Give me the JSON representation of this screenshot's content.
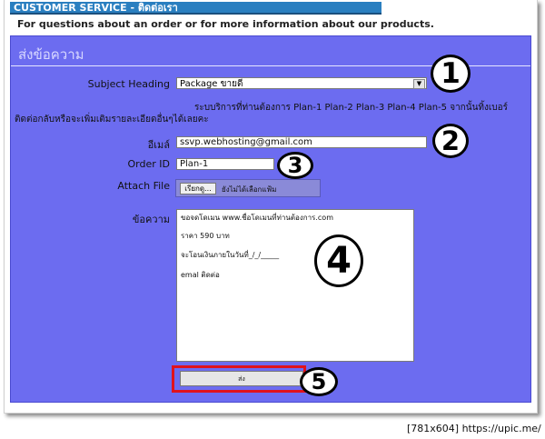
{
  "title_bar": "CUSTOMER SERVICE - ติดต่อเรา",
  "subtitle": "For questions about an order or for more information about our products.",
  "panel_title": "ส่งข้อความ",
  "form": {
    "subject_label": "Subject Heading",
    "subject_value": "Package ขายดี",
    "plan_text_line1": "ระบบริการที่ท่านต้องการ Plan-1 Plan-2 Plan-3 Plan-4 Plan-5 จากนั้นทิ้งเบอร์",
    "plan_text_line2": "ติดต่อกลับหรือจะเพิ่มเติมรายละเอียดอื่นๆได้เลยคะ",
    "email_label": "อีเมล์",
    "email_value": "ssvp.webhosting@gmail.com",
    "order_label": "Order ID",
    "order_value": "Plan-1",
    "attach_label": "Attach File",
    "browse_label": "เรียกดู...",
    "no_file_text": "ยังไม่ได้เลือกแฟ้ม",
    "message_label": "ข้อความ",
    "message_lines": [
      "ขอจดโดเมน  www.ชื่อโดเมนที่ท่านต้องการ.com",
      "ราคา 590 บาท",
      "จะโอนเงินภายในวันที่_/_/_____",
      "emal ติดต่อ"
    ],
    "submit_label": "ส่ง"
  },
  "markers": [
    "1",
    "2",
    "3",
    "4",
    "5"
  ],
  "watermark": "[781x604] https://upic.me/"
}
